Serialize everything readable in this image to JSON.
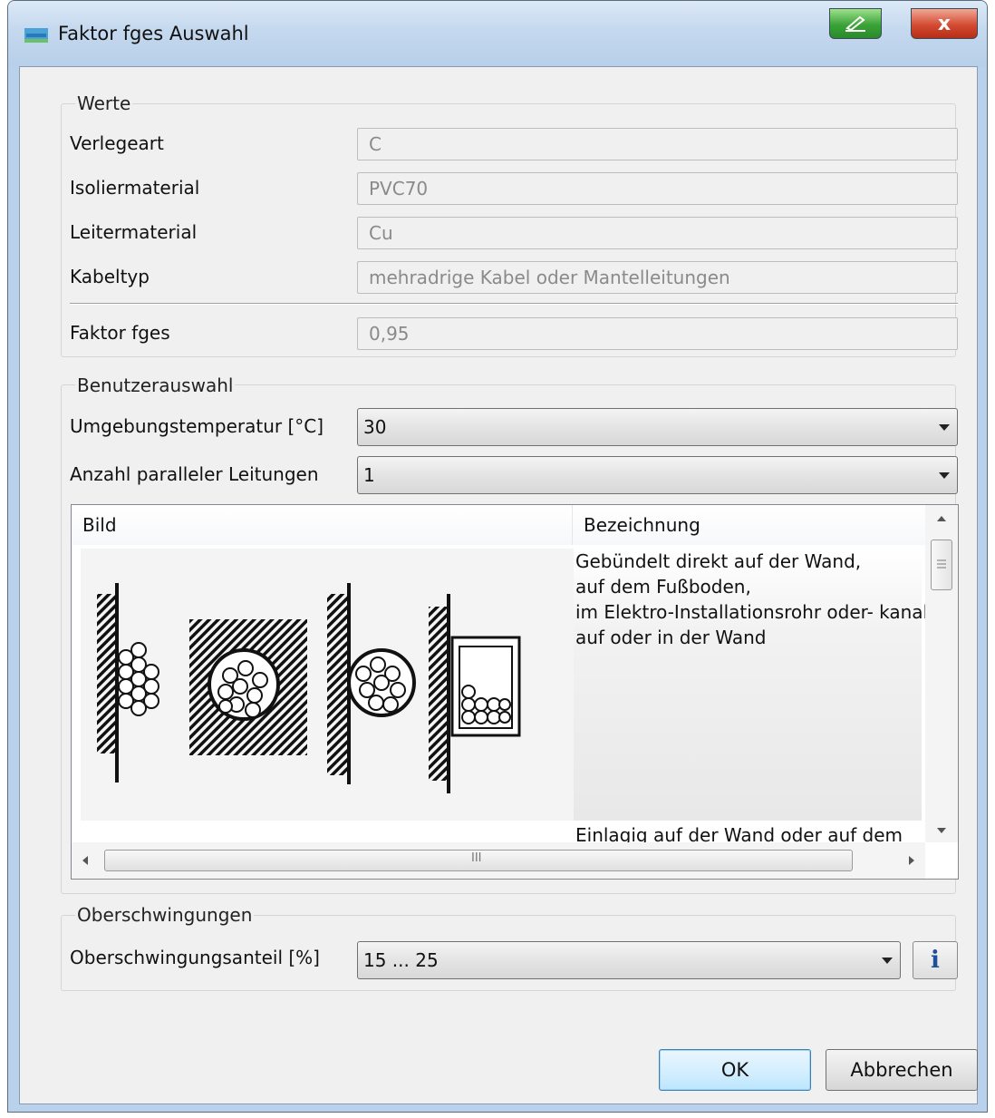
{
  "window": {
    "title": "Faktor fges Auswahl",
    "close_glyph": "x"
  },
  "werte": {
    "group_title": "Werte",
    "fields": [
      {
        "label": "Verlegeart",
        "value": "C"
      },
      {
        "label": "Isoliermaterial",
        "value": "PVC70"
      },
      {
        "label": "Leitermaterial",
        "value": "Cu"
      },
      {
        "label": "Kabeltyp",
        "value": "mehradrige Kabel oder Mantelleitungen"
      }
    ],
    "faktor": {
      "label": "Faktor fges",
      "value": "0,95"
    }
  },
  "benutzerauswahl": {
    "group_title": "Benutzerauswahl",
    "temperatur": {
      "label": "Umgebungstemperatur [°C]",
      "value": "30"
    },
    "parallel": {
      "label": "Anzahl paralleler Leitungen",
      "value": "1"
    },
    "table": {
      "col_bild": "Bild",
      "col_bezeichnung": "Bezeichnung",
      "rows": [
        {
          "lines": [
            "Gebündelt direkt auf der Wand,",
            "auf dem Fußboden,",
            "im Elektro-Installationsrohr oder- kanal",
            "auf oder in der Wand"
          ]
        },
        {
          "lines": [
            "Einlagig auf der Wand oder auf dem"
          ]
        }
      ],
      "hscroll_grip": "III"
    }
  },
  "oberschwingungen": {
    "group_title": "Oberschwingungen",
    "label": "Oberschwingungsanteil [%]",
    "value": "15 ... 25",
    "info_glyph": "i"
  },
  "buttons": {
    "ok": "OK",
    "cancel": "Abbrechen"
  }
}
